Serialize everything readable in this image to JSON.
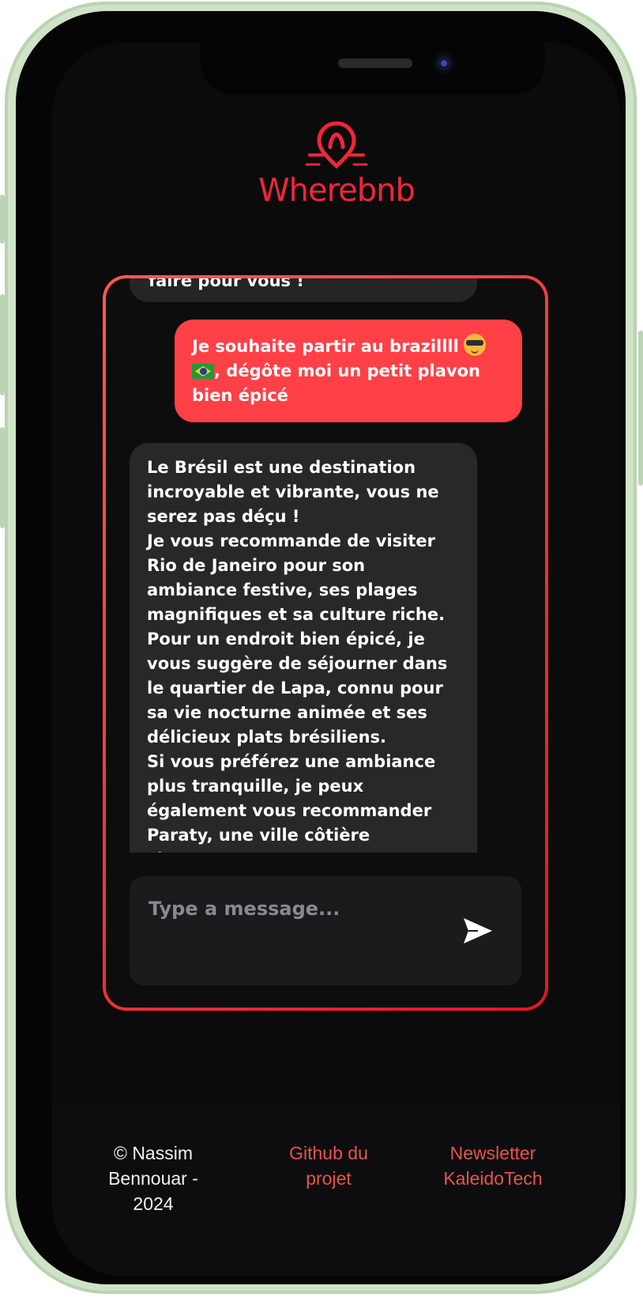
{
  "app": {
    "brand_name": "Wherebnb",
    "brand_color": "#f0263a",
    "logo_icon": "map-pin-icon"
  },
  "chat": {
    "previous_bot_tail": "faire pour vous !",
    "user_message": {
      "text": "Je souhaite partir au brazillll",
      "emoji_1": "smiling-face-with-sunglasses-icon",
      "emoji_2": "brazil-flag-icon",
      "text_after_flag": ", dégôte moi un petit plavon bien épicé"
    },
    "bot_message": {
      "lines": [
        "Le Brésil est une destination incroyable et vibrante, vous ne serez pas déçu !",
        "Je vous recommande de visiter Rio de Janeiro pour son ambiance festive, ses plages magnifiques et sa culture riche.",
        "Pour un endroit bien épicé, je vous suggère de séjourner dans le quartier de Lapa, connu pour sa vie nocturne animée et ses délicieux plats brésiliens.",
        "Si vous préférez une ambiance plus tranquille, je peux également vous recommander Paraty, une ville côtière charmante avec une"
      ]
    },
    "composer": {
      "placeholder": "Type a message...",
      "value": "",
      "send_icon": "send-icon"
    },
    "colors": {
      "user_bubble": "#ff4046",
      "bot_bubble": "#28282b",
      "border_gradient_start": "#ff5a4d",
      "border_gradient_end": "#e0162b"
    }
  },
  "footer": {
    "copyright": "© Nassim Bennouar - 2024",
    "github_link": "Github du projet",
    "newsletter_link": "Newsletter KaleidoTech",
    "link_color": "#e8534b"
  }
}
